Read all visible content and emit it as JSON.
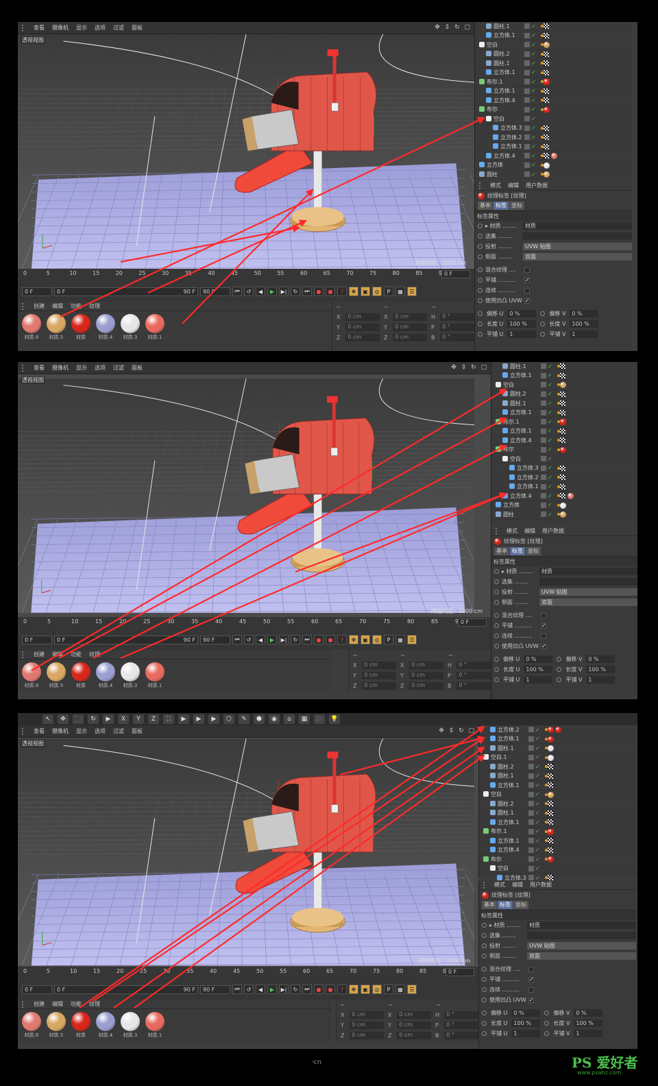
{
  "viewport_menu": [
    "查看",
    "摄像机",
    "显示",
    "选项",
    "过滤",
    "面板"
  ],
  "viewport_label": "透视视图",
  "grid_size": "网格间距：1000 cm",
  "ruler_ticks": [
    "0",
    "5",
    "10",
    "15",
    "20",
    "25",
    "30",
    "35",
    "40",
    "45",
    "50",
    "55",
    "60",
    "65",
    "70",
    "75",
    "80",
    "85",
    "90"
  ],
  "frame_current": "0 F",
  "frame_start": "0 F",
  "frame_slider": "0 F",
  "frame_slider_end": "90 F",
  "frame_end": "90 F",
  "material_menu": [
    "创建",
    "编辑",
    "功能",
    "纹理"
  ],
  "materials": [
    {
      "name": "材质.6",
      "color": "#e07a70"
    },
    {
      "name": "材质.5",
      "color": "#d9a764"
    },
    {
      "name": "材质",
      "color": "#d8261a"
    },
    {
      "name": "材质.4",
      "color": "#9a9ed0"
    },
    {
      "name": "材质.3",
      "color": "#e6e6e6"
    },
    {
      "name": "材质.1",
      "color": "#e86a5e"
    }
  ],
  "coords": [
    {
      "a": "X",
      "av": "0 cm",
      "b": "X",
      "bv": "0 cm",
      "c": "H",
      "cv": "0 °"
    },
    {
      "a": "Y",
      "av": "0 cm",
      "b": "Y",
      "bv": "0 cm",
      "c": "P",
      "cv": "0 °"
    },
    {
      "a": "Z",
      "av": "0 cm",
      "b": "Z",
      "bv": "0 cm",
      "c": "B",
      "cv": "0 °"
    }
  ],
  "coord_sep": "--",
  "objects": [
    {
      "name": "圆柱.1",
      "indent": 1,
      "icon": "#8ac",
      "tags": [
        "dot",
        "chk"
      ]
    },
    {
      "name": "立方体.1",
      "indent": 1,
      "icon": "#6ae",
      "tags": [
        "dot",
        "chk"
      ]
    },
    {
      "name": "空白",
      "indent": 0,
      "icon": "#eee",
      "tags": [
        "dot",
        "ball-tan"
      ]
    },
    {
      "name": "圆柱.2",
      "indent": 1,
      "icon": "#8ac",
      "tags": [
        "dot",
        "chk"
      ]
    },
    {
      "name": "圆柱.1",
      "indent": 1,
      "icon": "#8ac",
      "tags": [
        "dot",
        "chk"
      ]
    },
    {
      "name": "立方体.1",
      "indent": 1,
      "icon": "#6ae",
      "tags": [
        "dot",
        "chk"
      ]
    },
    {
      "name": "布尔.1",
      "indent": 0,
      "icon": "#7c7",
      "tags": [
        "dot",
        "sq-red"
      ]
    },
    {
      "name": "立方体.1",
      "indent": 1,
      "icon": "#6ae",
      "tags": [
        "dot",
        "chk"
      ]
    },
    {
      "name": "立方体.4",
      "indent": 1,
      "icon": "#6ae",
      "tags": [
        "dot",
        "chk"
      ]
    },
    {
      "name": "布尔",
      "indent": 0,
      "icon": "#7c7",
      "tags": [
        "dot",
        "ball-red"
      ]
    },
    {
      "name": "空白",
      "indent": 1,
      "icon": "#eee",
      "tags": []
    },
    {
      "name": "立方体.3",
      "indent": 2,
      "icon": "#6ae",
      "tags": [
        "dot",
        "chk"
      ]
    },
    {
      "name": "立方体.2",
      "indent": 2,
      "icon": "#6ae",
      "tags": [
        "dot",
        "chk"
      ]
    },
    {
      "name": "立方体.1",
      "indent": 2,
      "icon": "#6ae",
      "tags": [
        "dot",
        "chk"
      ]
    },
    {
      "name": "立方体.4",
      "indent": 1,
      "icon": "#6ae",
      "tags": [
        "dot",
        "chk",
        "ball-pink"
      ]
    },
    {
      "name": "立方体",
      "indent": 0,
      "icon": "#6ae",
      "tags": [
        "dot",
        "ball-white"
      ]
    },
    {
      "name": "圆柱",
      "indent": 0,
      "icon": "#8ac",
      "tags": [
        "dot",
        "ball-tan"
      ]
    }
  ],
  "objects_p3": [
    {
      "name": "立方体.2",
      "indent": 1,
      "icon": "#6ae",
      "tags": [
        "dot",
        "ball-red",
        "ball-red"
      ]
    },
    {
      "name": "立方体.1",
      "indent": 1,
      "icon": "#6ae",
      "tags": [
        "dot",
        "ball-red"
      ]
    },
    {
      "name": "圆柱.1",
      "indent": 1,
      "icon": "#8ac",
      "tags": [
        "dot",
        "ball-white"
      ]
    },
    {
      "name": "空白.1",
      "indent": 0,
      "icon": "#eee",
      "tags": [
        "dot",
        "ball-white"
      ]
    },
    {
      "name": "圆柱.2",
      "indent": 1,
      "icon": "#8ac",
      "tags": [
        "dot",
        "chk"
      ]
    },
    {
      "name": "圆柱.1",
      "indent": 1,
      "icon": "#8ac",
      "tags": [
        "dot",
        "chk"
      ]
    },
    {
      "name": "立方体.1",
      "indent": 1,
      "icon": "#6ae",
      "tags": [
        "dot",
        "chk"
      ]
    },
    {
      "name": "空白",
      "indent": 0,
      "icon": "#eee",
      "tags": [
        "dot",
        "ball-tan"
      ]
    },
    {
      "name": "圆柱.2",
      "indent": 1,
      "icon": "#8ac",
      "tags": [
        "dot",
        "chk"
      ]
    },
    {
      "name": "圆柱.1",
      "indent": 1,
      "icon": "#8ac",
      "tags": [
        "dot",
        "chk"
      ]
    },
    {
      "name": "立方体.1",
      "indent": 1,
      "icon": "#6ae",
      "tags": [
        "dot",
        "chk"
      ]
    },
    {
      "name": "布尔.1",
      "indent": 0,
      "icon": "#7c7",
      "tags": [
        "dot",
        "sq-red"
      ]
    },
    {
      "name": "立方体.1",
      "indent": 1,
      "icon": "#6ae",
      "tags": [
        "dot",
        "chk"
      ]
    },
    {
      "name": "立方体.4",
      "indent": 1,
      "icon": "#6ae",
      "tags": [
        "dot",
        "chk"
      ]
    },
    {
      "name": "布尔",
      "indent": 0,
      "icon": "#7c7",
      "tags": [
        "dot",
        "ball-red"
      ]
    },
    {
      "name": "空白",
      "indent": 1,
      "icon": "#eee",
      "tags": []
    },
    {
      "name": "立方体.3",
      "indent": 2,
      "icon": "#6ae",
      "tags": [
        "dot",
        "chk"
      ]
    }
  ],
  "attr_menu": [
    "模式",
    "编辑",
    "用户数据"
  ],
  "attr_title": "纹理标签 [纹理]",
  "attr_tabs": [
    "基本",
    "标签",
    "坐标"
  ],
  "attr_section": "标签属性",
  "attr_rows": [
    {
      "label": "▸ 材质 ........",
      "value": "材质",
      "dd": false
    },
    {
      "label": "选集 ........",
      "value": "",
      "dd": false
    },
    {
      "label": "投射 ........",
      "value": "UVW 贴图",
      "dd": true
    },
    {
      "label": "侧面 ........",
      "value": "双面",
      "dd": true
    }
  ],
  "attr_checks": [
    {
      "label": "混合纹理 ....",
      "checked": ""
    },
    {
      "label": "平铺 ..........",
      "checked": "✓"
    },
    {
      "label": "连续 ..........",
      "checked": ""
    },
    {
      "label": "使用凹凸 UVW",
      "checked": "✓"
    }
  ],
  "attr_pairs": [
    {
      "l1": "偏移 U",
      "v1": "0 %",
      "l2": "偏移 V",
      "v2": "0 %"
    },
    {
      "l1": "长度 U",
      "v1": "100 %",
      "l2": "长度 V",
      "v2": "100 %"
    },
    {
      "l1": "平铺 U",
      "v1": "1",
      "l2": "平铺 V",
      "v2": "1"
    }
  ],
  "toolbar3": [
    "↖",
    "✥",
    "⬛",
    "↻",
    "▶",
    "X",
    "Y",
    "Z",
    "⛶",
    "▶",
    "▶",
    "▶",
    "⬡",
    "✎",
    "⬢",
    "◉",
    "⌂",
    "▦",
    "🎥",
    "💡"
  ],
  "watermark": "·cn",
  "ps_badge": "PS 爱好者",
  "ps_url": "www.psahz.com",
  "colors": {
    "mailbox": "#e8574a",
    "mailbox_dark": "#b83a30",
    "base": "#e3b573",
    "floor": "#b8b8e8",
    "arrow": "#ff2a2a"
  }
}
